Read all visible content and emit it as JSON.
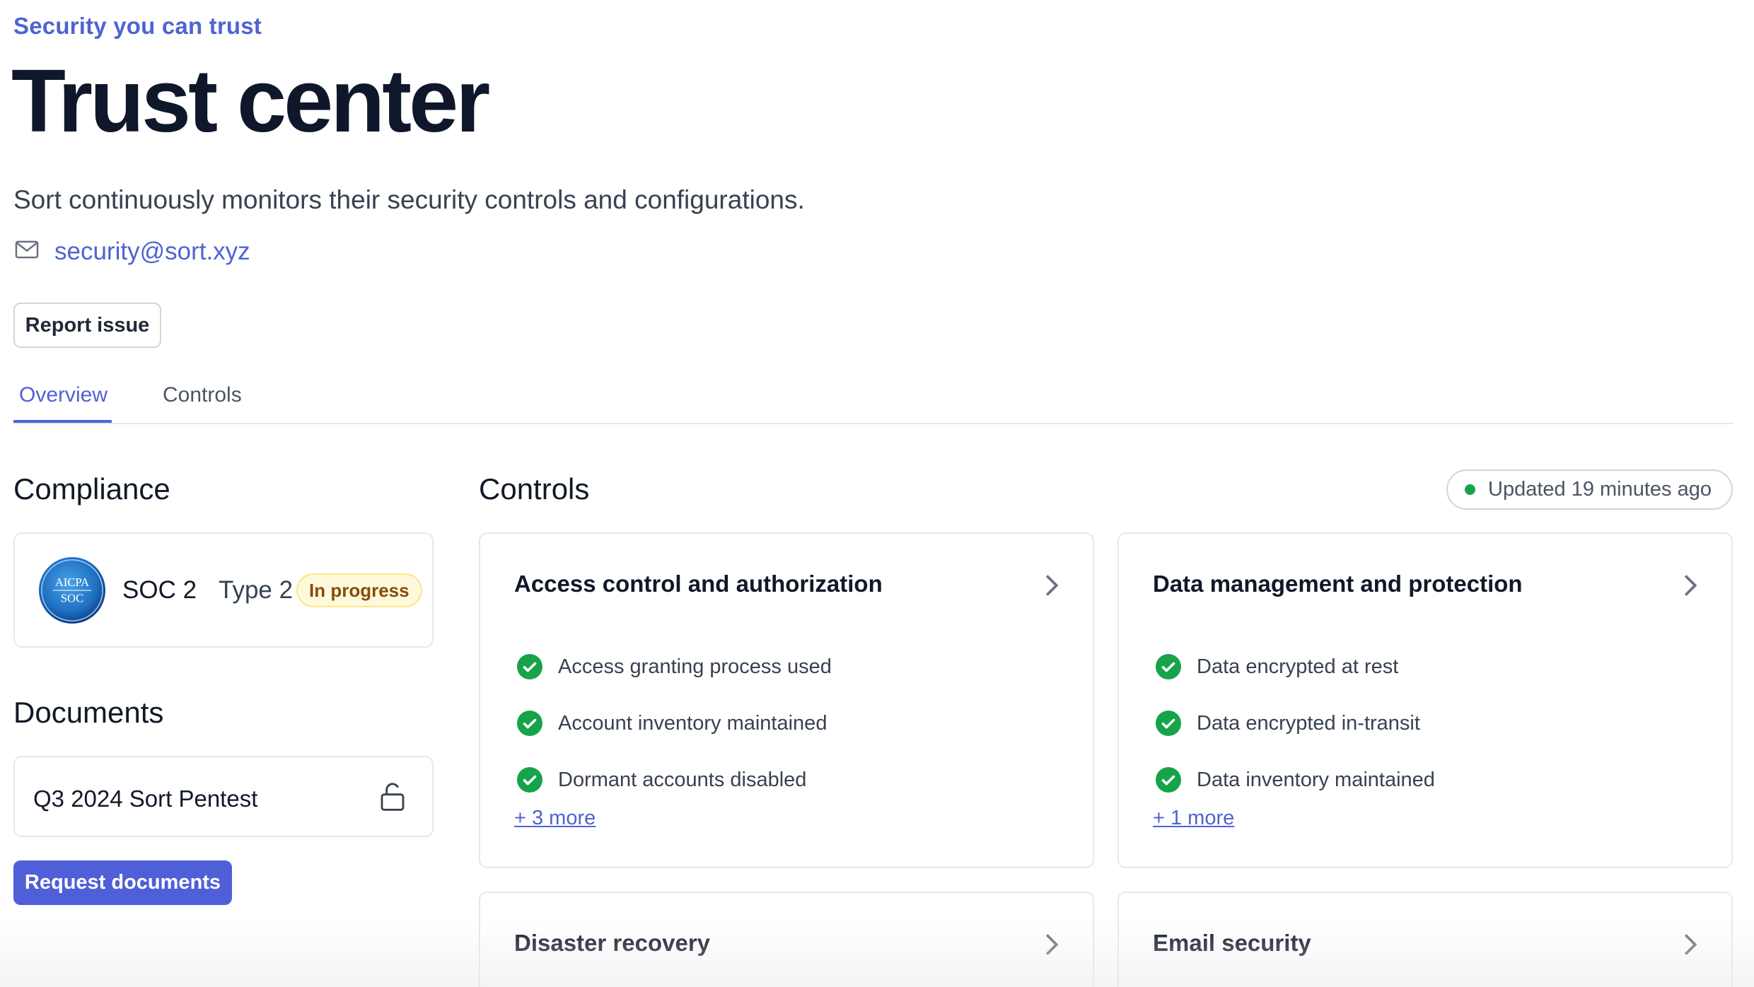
{
  "header": {
    "eyebrow": "Security you can trust",
    "title": "Trust center",
    "subtitle": "Sort continuously monitors their security controls and configurations.",
    "email": "security@sort.xyz",
    "report_label": "Report issue"
  },
  "tabs": [
    {
      "label": "Overview",
      "active": true
    },
    {
      "label": "Controls",
      "active": false
    }
  ],
  "compliance": {
    "heading": "Compliance",
    "logo_top": "AICPA",
    "logo_bottom": "SOC",
    "name": "SOC 2",
    "type": "Type 2",
    "status": "In progress"
  },
  "documents": {
    "heading": "Documents",
    "items": [
      {
        "name": "Q3 2024 Sort Pentest",
        "icon": "unlock-icon"
      }
    ],
    "request_label": "Request documents"
  },
  "controls": {
    "heading": "Controls",
    "updated": "Updated 19 minutes ago",
    "cards": [
      {
        "title": "Access control and authorization",
        "items": [
          "Access granting process used",
          "Account inventory maintained",
          "Dormant accounts disabled"
        ],
        "more": "+ 3 more"
      },
      {
        "title": "Data management and protection",
        "items": [
          "Data encrypted at rest",
          "Data encrypted in-transit",
          "Data inventory maintained"
        ],
        "more": "+ 1 more"
      },
      {
        "title": "Disaster recovery"
      },
      {
        "title": "Email security"
      }
    ]
  },
  "colors": {
    "accent": "#4f63d2",
    "success": "#16a34a",
    "badge_bg": "#fef9db",
    "badge_text": "#854d0e"
  }
}
